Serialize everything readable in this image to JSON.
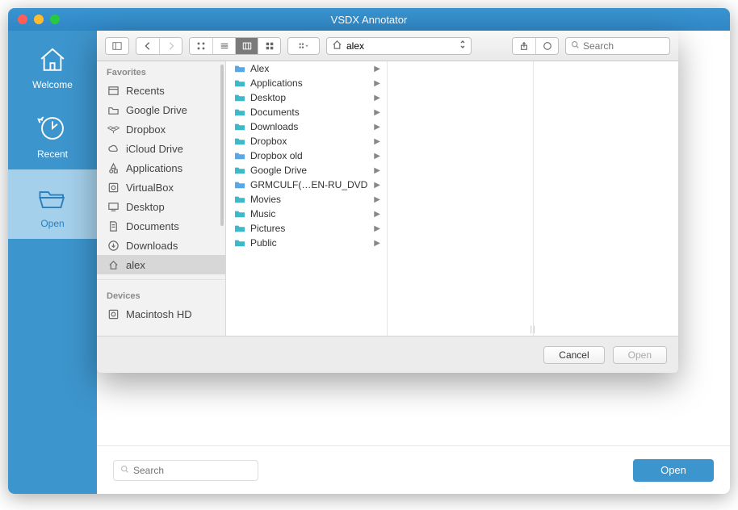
{
  "window": {
    "title": "VSDX Annotator"
  },
  "rail": {
    "items": [
      {
        "id": "welcome",
        "label": "Welcome",
        "icon": "home-icon"
      },
      {
        "id": "recent",
        "label": "Recent",
        "icon": "clock-icon"
      },
      {
        "id": "open",
        "label": "Open",
        "icon": "folder-open-icon"
      }
    ],
    "active": "open"
  },
  "main_bar": {
    "search_placeholder": "Search",
    "open_label": "Open"
  },
  "dialog": {
    "path_label": "alex",
    "search_placeholder": "Search",
    "sidebar": {
      "sections": [
        {
          "title": "Favorites",
          "items": [
            {
              "label": "Recents",
              "icon": "recents-icon"
            },
            {
              "label": "Google Drive",
              "icon": "folder-icon"
            },
            {
              "label": "Dropbox",
              "icon": "dropbox-icon"
            },
            {
              "label": "iCloud Drive",
              "icon": "cloud-icon"
            },
            {
              "label": "Applications",
              "icon": "apps-icon"
            },
            {
              "label": "VirtualBox",
              "icon": "disk-icon"
            },
            {
              "label": "Desktop",
              "icon": "desktop-icon"
            },
            {
              "label": "Documents",
              "icon": "document-icon"
            },
            {
              "label": "Downloads",
              "icon": "downloads-icon"
            },
            {
              "label": "alex",
              "icon": "home-small-icon",
              "selected": true
            }
          ]
        },
        {
          "title": "Devices",
          "items": [
            {
              "label": "Macintosh HD",
              "icon": "disk-icon"
            }
          ]
        }
      ]
    },
    "column": {
      "items": [
        {
          "label": "Alex",
          "kind": "folder",
          "tint": "blue"
        },
        {
          "label": "Applications",
          "kind": "folder",
          "tint": "teal"
        },
        {
          "label": "Desktop",
          "kind": "folder",
          "tint": "teal"
        },
        {
          "label": "Documents",
          "kind": "folder",
          "tint": "teal"
        },
        {
          "label": "Downloads",
          "kind": "folder",
          "tint": "teal"
        },
        {
          "label": "Dropbox",
          "kind": "folder",
          "tint": "teal"
        },
        {
          "label": "Dropbox old",
          "kind": "folder",
          "tint": "blue"
        },
        {
          "label": "Google Drive",
          "kind": "folder",
          "tint": "teal"
        },
        {
          "label": "GRMCULF(…EN-RU_DVD",
          "kind": "folder",
          "tint": "blue"
        },
        {
          "label": "Movies",
          "kind": "folder",
          "tint": "teal"
        },
        {
          "label": "Music",
          "kind": "folder",
          "tint": "teal"
        },
        {
          "label": "Pictures",
          "kind": "folder",
          "tint": "teal"
        },
        {
          "label": "Public",
          "kind": "folder",
          "tint": "teal"
        }
      ]
    },
    "buttons": {
      "cancel": "Cancel",
      "open": "Open"
    }
  }
}
